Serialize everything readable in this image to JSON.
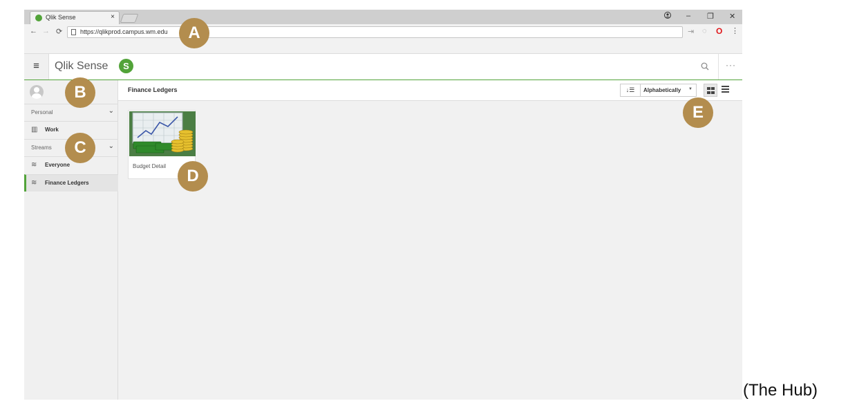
{
  "browser": {
    "tab_title": "Qlik Sense",
    "tab_close": "×",
    "url": "https://qlikprod.campus.wm.edu",
    "window_controls": {
      "minimize": "–",
      "restore": "❐",
      "close": "✕"
    }
  },
  "header": {
    "menu_glyph": "≡",
    "brand": "Qlik Sense",
    "brand_logo_letter": "S",
    "more_glyph": "···"
  },
  "sidebar": {
    "personal_label": "Personal",
    "work_label": "Work",
    "streams_label": "Streams",
    "streams": [
      {
        "label": "Everyone"
      },
      {
        "label": "Finance Ledgers",
        "active": true
      }
    ]
  },
  "main": {
    "title": "Finance Ledgers",
    "sort_label": "Alphabetically",
    "apps": [
      {
        "title": "Budget Detail"
      }
    ]
  },
  "callouts": [
    "A",
    "B",
    "C",
    "D",
    "E"
  ],
  "caption": "(The Hub)",
  "colors": {
    "accent": "#52a339",
    "callout": "#b38d4e",
    "opera": "#e0191c"
  }
}
